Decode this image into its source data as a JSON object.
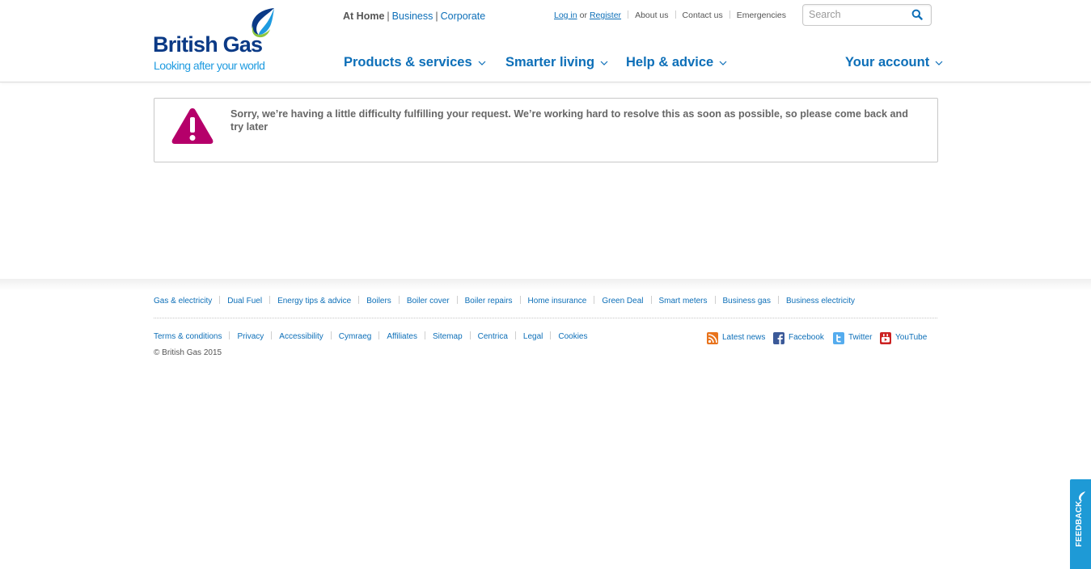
{
  "brand": {
    "name": "British Gas",
    "tagline": "Looking after your world",
    "colors": {
      "navy": "#0b3a86",
      "blue": "#0d6fb8",
      "light_blue": "#1e9be0",
      "green": "#8dc63f",
      "warning": "#b5006a"
    }
  },
  "header": {
    "segments": {
      "current": "At Home",
      "business": "Business",
      "corporate": "Corporate"
    },
    "utility": {
      "login": "Log in",
      "or": "or",
      "register": "Register",
      "about": "About us",
      "contact": "Contact us",
      "emergencies": "Emergencies"
    },
    "search": {
      "placeholder": "Search",
      "icon": "search-icon"
    },
    "nav": {
      "products": "Products & services",
      "smarter": "Smarter living",
      "help": "Help & advice",
      "account": "Your account"
    }
  },
  "error": {
    "icon": "warning-icon",
    "message": "Sorry, we’re having a little difficulty fulfilling your request. We’re working hard to resolve this as soon as possible, so please come back and try later"
  },
  "footer": {
    "product_links": [
      "Gas & electricity",
      "Dual Fuel",
      "Energy tips & advice",
      "Boilers",
      "Boiler cover",
      "Boiler repairs",
      "Home insurance",
      "Green Deal",
      "Smart meters",
      "Business gas",
      "Business electricity"
    ],
    "legal_links": [
      "Terms & conditions",
      "Privacy",
      "Accessibility",
      "Cymraeg",
      "Affiliates",
      "Sitemap",
      "Centrica",
      "Legal",
      "Cookies"
    ],
    "copyright": "© British Gas 2015",
    "social": {
      "news": "Latest news",
      "facebook": "Facebook",
      "twitter": "Twitter",
      "youtube": "YouTube"
    }
  },
  "feedback": {
    "label": "FEEDBACK"
  }
}
